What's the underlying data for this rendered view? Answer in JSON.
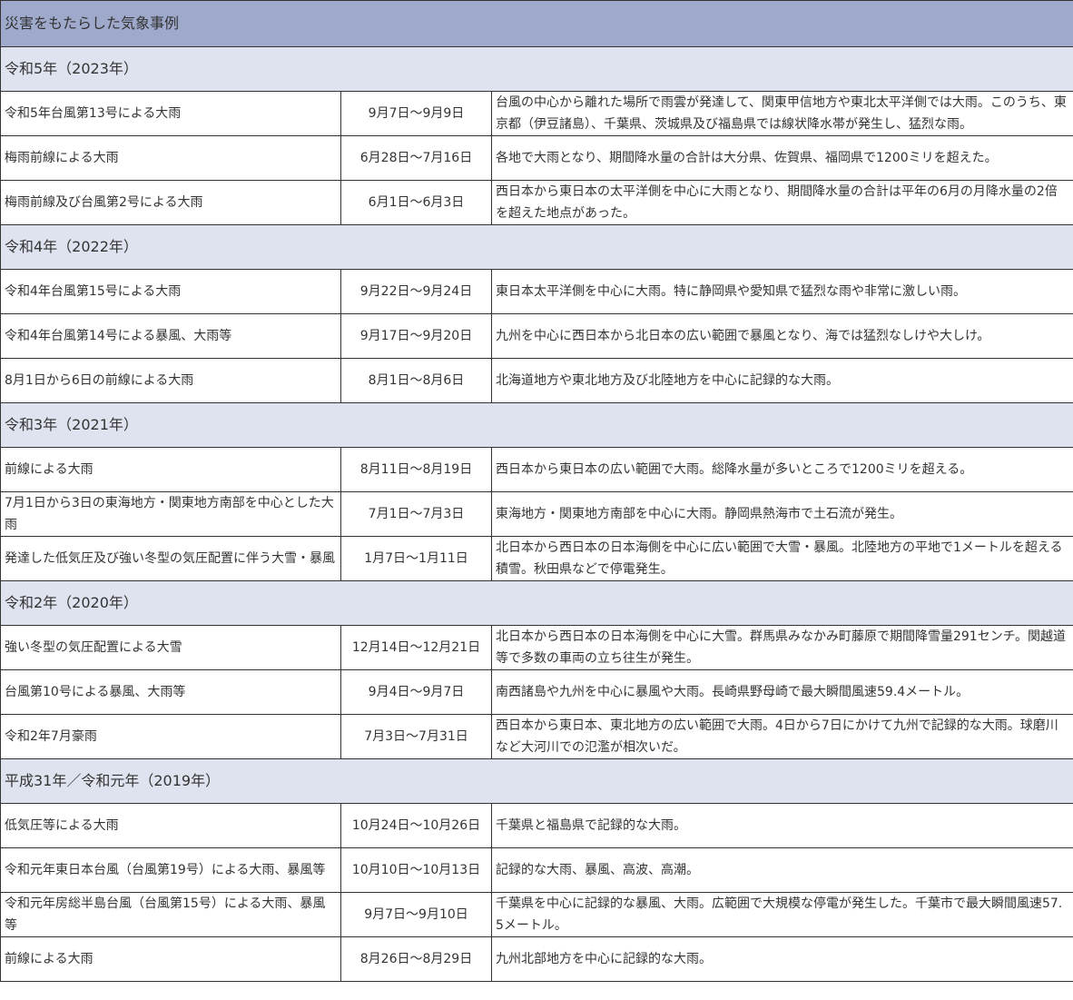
{
  "title": "災害をもたらした気象事例",
  "groups": [
    {
      "year": "令和5年（2023年）",
      "events": [
        {
          "name": "令和5年台風第13号による大雨",
          "period": "9月7日～9月9日",
          "desc": "台風の中心から離れた場所で雨雲が発達して、関東甲信地方や東北太平洋側では大雨。このうち、東京都（伊豆諸島）、千葉県、茨城県及び福島県では線状降水帯が発生し、猛烈な雨。"
        },
        {
          "name": "梅雨前線による大雨",
          "period": "6月28日～7月16日",
          "desc": "各地で大雨となり、期間降水量の合計は大分県、佐賀県、福岡県で1200ミリを超えた。"
        },
        {
          "name": "梅雨前線及び台風第2号による大雨",
          "period": "6月1日～6月3日",
          "desc": "西日本から東日本の太平洋側を中心に大雨となり、期間降水量の合計は平年の6月の月降水量の2倍を超えた地点があった。"
        }
      ]
    },
    {
      "year": "令和4年（2022年）",
      "events": [
        {
          "name": "令和4年台風第15号による大雨",
          "period": "9月22日～9月24日",
          "desc": "東日本太平洋側を中心に大雨。特に静岡県や愛知県で猛烈な雨や非常に激しい雨。"
        },
        {
          "name": "令和4年台風第14号による暴風、大雨等",
          "period": "9月17日～9月20日",
          "desc": "九州を中心に西日本から北日本の広い範囲で暴風となり、海では猛烈なしけや大しけ。"
        },
        {
          "name": "8月1日から6日の前線による大雨",
          "period": "8月1日～8月6日",
          "desc": "北海道地方や東北地方及び北陸地方を中心に記録的な大雨。"
        }
      ]
    },
    {
      "year": "令和3年（2021年）",
      "events": [
        {
          "name": "前線による大雨",
          "period": "8月11日～8月19日",
          "desc": "西日本から東日本の広い範囲で大雨。総降水量が多いところで1200ミリを超える。"
        },
        {
          "name": "7月1日から3日の東海地方・関東地方南部を中心とした大雨",
          "period": "7月1日～7月3日",
          "desc": "東海地方・関東地方南部を中心に大雨。静岡県熱海市で土石流が発生。"
        },
        {
          "name": "発達した低気圧及び強い冬型の気圧配置に伴う大雪・暴風",
          "period": "1月7日～1月11日",
          "desc": "北日本から西日本の日本海側を中心に広い範囲で大雪・暴風。北陸地方の平地で1メートルを超える積雪。秋田県などで停電発生。"
        }
      ]
    },
    {
      "year": "令和2年（2020年）",
      "events": [
        {
          "name": "強い冬型の気圧配置による大雪",
          "period": "12月14日～12月21日",
          "desc": "北日本から西日本の日本海側を中心に大雪。群馬県みなかみ町藤原で期間降雪量291センチ。関越道等で多数の車両の立ち往生が発生。"
        },
        {
          "name": "台風第10号による暴風、大雨等",
          "period": "9月4日～9月7日",
          "desc": "南西諸島や九州を中心に暴風や大雨。長崎県野母崎で最大瞬間風速59.4メートル。"
        },
        {
          "name": "令和2年7月豪雨",
          "period": "7月3日～7月31日",
          "desc": "西日本から東日本、東北地方の広い範囲で大雨。4日から7日にかけて九州で記録的な大雨。球磨川など大河川での氾濫が相次いだ。"
        }
      ]
    },
    {
      "year": "平成31年／令和元年（2019年）",
      "events": [
        {
          "name": "低気圧等による大雨",
          "period": "10月24日～10月26日",
          "desc": "千葉県と福島県で記録的な大雨。"
        },
        {
          "name": "令和元年東日本台風（台風第19号）による大雨、暴風等",
          "period": "10月10日～10月13日",
          "desc": "記録的な大雨、暴風、高波、高潮。"
        },
        {
          "name": "令和元年房総半島台風（台風第15号）による大雨、暴風等",
          "period": "9月7日～9月10日",
          "desc": "千葉県を中心に記録的な暴風、大雨。広範囲で大規模な停電が発生した。千葉市で最大瞬間風速57.5メートル。"
        },
        {
          "name": "前線による大雨",
          "period": "8月26日～8月29日",
          "desc": "九州北部地方を中心に記録的な大雨。"
        }
      ]
    }
  ]
}
